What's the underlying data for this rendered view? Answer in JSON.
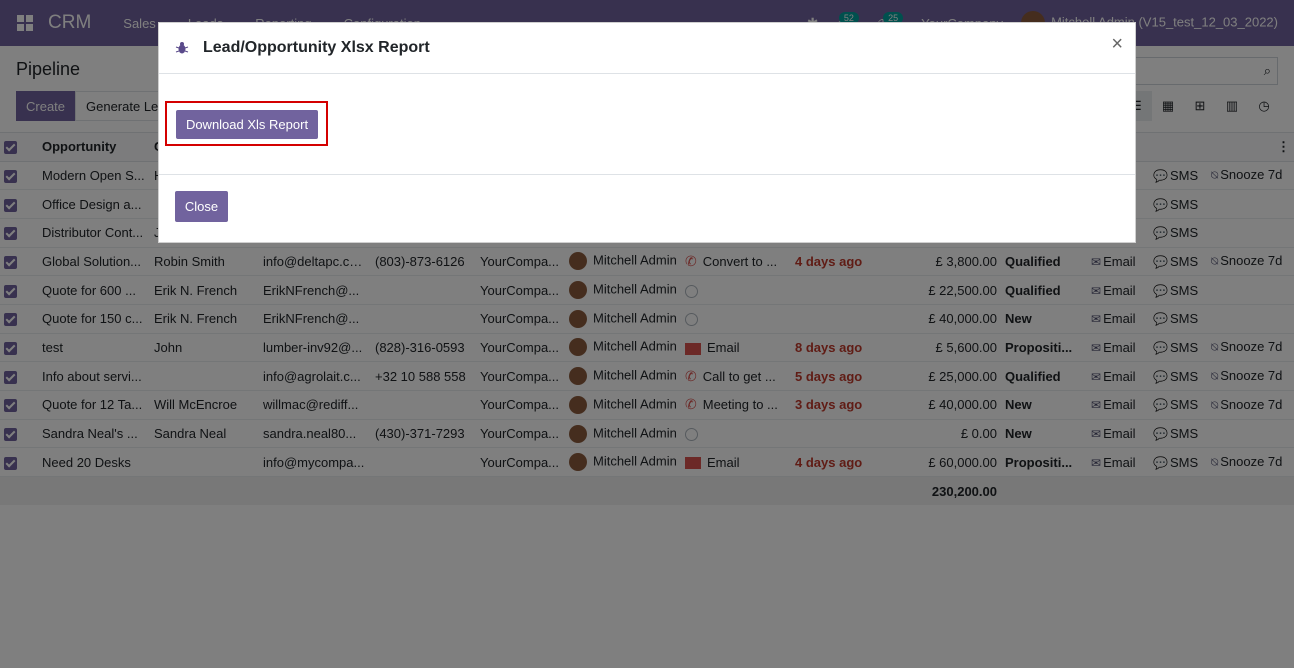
{
  "navbar": {
    "brand": "CRM",
    "menu": [
      "Sales",
      "Leads",
      "Reporting",
      "Configuration"
    ],
    "messages_count": "52",
    "activities_count": "25",
    "company": "YourCompany",
    "user": "Mitchell Admin (V15_test_12_03_2022)"
  },
  "control_panel": {
    "title": "Pipeline",
    "create_label": "Create",
    "generate_label": "Generate Le"
  },
  "table": {
    "headers": [
      "Opportunity",
      "C"
    ],
    "rows": [
      {
        "opportunity": "Modern Open S...",
        "contact": "H",
        "email": "",
        "phone": "",
        "company": "",
        "salesperson": "",
        "activity_type": "",
        "activity": "",
        "deadline": "",
        "revenue": "",
        "stage": "",
        "email_btn": "",
        "sms_btn": "SMS",
        "snooze": "Snooze 7d"
      },
      {
        "opportunity": "Office Design a...",
        "contact": "",
        "email": "",
        "phone": "",
        "company": "",
        "salesperson": "",
        "activity_type": "",
        "activity": "",
        "deadline": "",
        "revenue": "",
        "stage": "",
        "email_btn": "",
        "sms_btn": "SMS",
        "snooze": ""
      },
      {
        "opportunity": "Distributor Cont...",
        "contact": "J",
        "email": "",
        "phone": "",
        "company": "",
        "salesperson": "",
        "activity_type": "",
        "activity": "",
        "deadline": "",
        "revenue": "",
        "stage": "",
        "email_btn": "",
        "sms_btn": "SMS",
        "snooze": ""
      },
      {
        "opportunity": "Global Solution...",
        "contact": "Robin Smith",
        "email": "info@deltapc.com",
        "phone": "(803)-873-6126",
        "company": "YourCompa...",
        "salesperson": "Mitchell Admin",
        "activity_type": "phone",
        "activity": "Convert to ...",
        "deadline": "4 days ago",
        "revenue": "£ 3,800.00",
        "stage": "Qualified",
        "email_btn": "Email",
        "sms_btn": "SMS",
        "snooze": "Snooze 7d"
      },
      {
        "opportunity": "Quote for 600 ...",
        "contact": "Erik N. French",
        "email": "ErikNFrench@...",
        "phone": "",
        "company": "YourCompa...",
        "salesperson": "Mitchell Admin",
        "activity_type": "clock",
        "activity": "",
        "deadline": "",
        "revenue": "£ 22,500.00",
        "stage": "Qualified",
        "email_btn": "Email",
        "sms_btn": "SMS",
        "snooze": ""
      },
      {
        "opportunity": "Quote for 150 c...",
        "contact": "Erik N. French",
        "email": "ErikNFrench@...",
        "phone": "",
        "company": "YourCompa...",
        "salesperson": "Mitchell Admin",
        "activity_type": "clock",
        "activity": "",
        "deadline": "",
        "revenue": "£ 40,000.00",
        "stage": "New",
        "email_btn": "Email",
        "sms_btn": "SMS",
        "snooze": ""
      },
      {
        "opportunity": "test",
        "contact": "John",
        "email": "lumber-inv92@...",
        "phone": "(828)-316-0593",
        "company": "YourCompa...",
        "salesperson": "Mitchell Admin",
        "activity_type": "email",
        "activity": "Email",
        "deadline": "8 days ago",
        "revenue": "£ 5,600.00",
        "stage": "Propositi...",
        "email_btn": "Email",
        "sms_btn": "SMS",
        "snooze": "Snooze 7d"
      },
      {
        "opportunity": "Info about servi...",
        "contact": "",
        "email": "info@agrolait.c...",
        "phone": "+32 10 588 558",
        "company": "YourCompa...",
        "salesperson": "Mitchell Admin",
        "activity_type": "phone",
        "activity": "Call to get ...",
        "deadline": "5 days ago",
        "revenue": "£ 25,000.00",
        "stage": "Qualified",
        "email_btn": "Email",
        "sms_btn": "SMS",
        "snooze": "Snooze 7d"
      },
      {
        "opportunity": "Quote for 12 Ta...",
        "contact": "Will McEncroe",
        "email": "willmac@rediff...",
        "phone": "",
        "company": "YourCompa...",
        "salesperson": "Mitchell Admin",
        "activity_type": "phone",
        "activity": "Meeting to ...",
        "deadline": "3 days ago",
        "revenue": "£ 40,000.00",
        "stage": "New",
        "email_btn": "Email",
        "sms_btn": "SMS",
        "snooze": "Snooze 7d"
      },
      {
        "opportunity": "Sandra Neal's ...",
        "contact": "Sandra Neal",
        "email": "sandra.neal80...",
        "phone": "(430)-371-7293",
        "company": "YourCompa...",
        "salesperson": "Mitchell Admin",
        "activity_type": "clock",
        "activity": "",
        "deadline": "",
        "revenue": "£ 0.00",
        "stage": "New",
        "email_btn": "Email",
        "sms_btn": "SMS",
        "snooze": ""
      },
      {
        "opportunity": "Need 20 Desks",
        "contact": "",
        "email": "info@mycompa...",
        "phone": "",
        "company": "YourCompa...",
        "salesperson": "Mitchell Admin",
        "activity_type": "email",
        "activity": "Email",
        "deadline": "4 days ago",
        "revenue": "£ 60,000.00",
        "stage": "Propositi...",
        "email_btn": "Email",
        "sms_btn": "SMS",
        "snooze": "Snooze 7d"
      }
    ],
    "total_revenue": "230,200.00"
  },
  "modal": {
    "title": "Lead/Opportunity Xlsx Report",
    "close_symbol": "×",
    "download_label": "Download Xls Report",
    "close_label": "Close",
    "highlight_color": "#d40000"
  },
  "colors": {
    "brand": "#71639e",
    "deadline": "#c0392b",
    "badge": "#00a09d"
  }
}
